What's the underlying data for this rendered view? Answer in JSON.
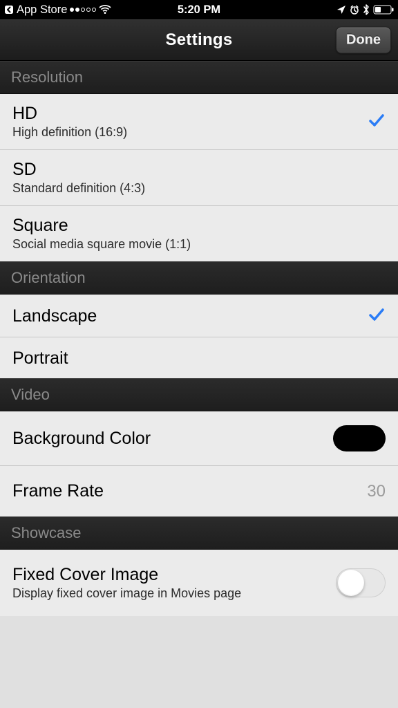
{
  "status": {
    "back_label": "App Store",
    "time": "5:20 PM"
  },
  "nav": {
    "title": "Settings",
    "done_label": "Done"
  },
  "resolution": {
    "header": "Resolution",
    "items": [
      {
        "title": "HD",
        "subtitle": "High definition (16:9)",
        "selected": true
      },
      {
        "title": "SD",
        "subtitle": "Standard definition (4:3)",
        "selected": false
      },
      {
        "title": "Square",
        "subtitle": "Social media square movie (1:1)",
        "selected": false
      }
    ]
  },
  "orientation": {
    "header": "Orientation",
    "items": [
      {
        "title": "Landscape",
        "selected": true
      },
      {
        "title": "Portrait",
        "selected": false
      }
    ]
  },
  "video": {
    "header": "Video",
    "background_color": {
      "label": "Background Color",
      "color": "#000000"
    },
    "frame_rate": {
      "label": "Frame Rate",
      "value": "30"
    }
  },
  "showcase": {
    "header": "Showcase",
    "fixed_cover": {
      "title": "Fixed Cover Image",
      "subtitle": "Display fixed cover image in Movies page",
      "enabled": false
    }
  }
}
